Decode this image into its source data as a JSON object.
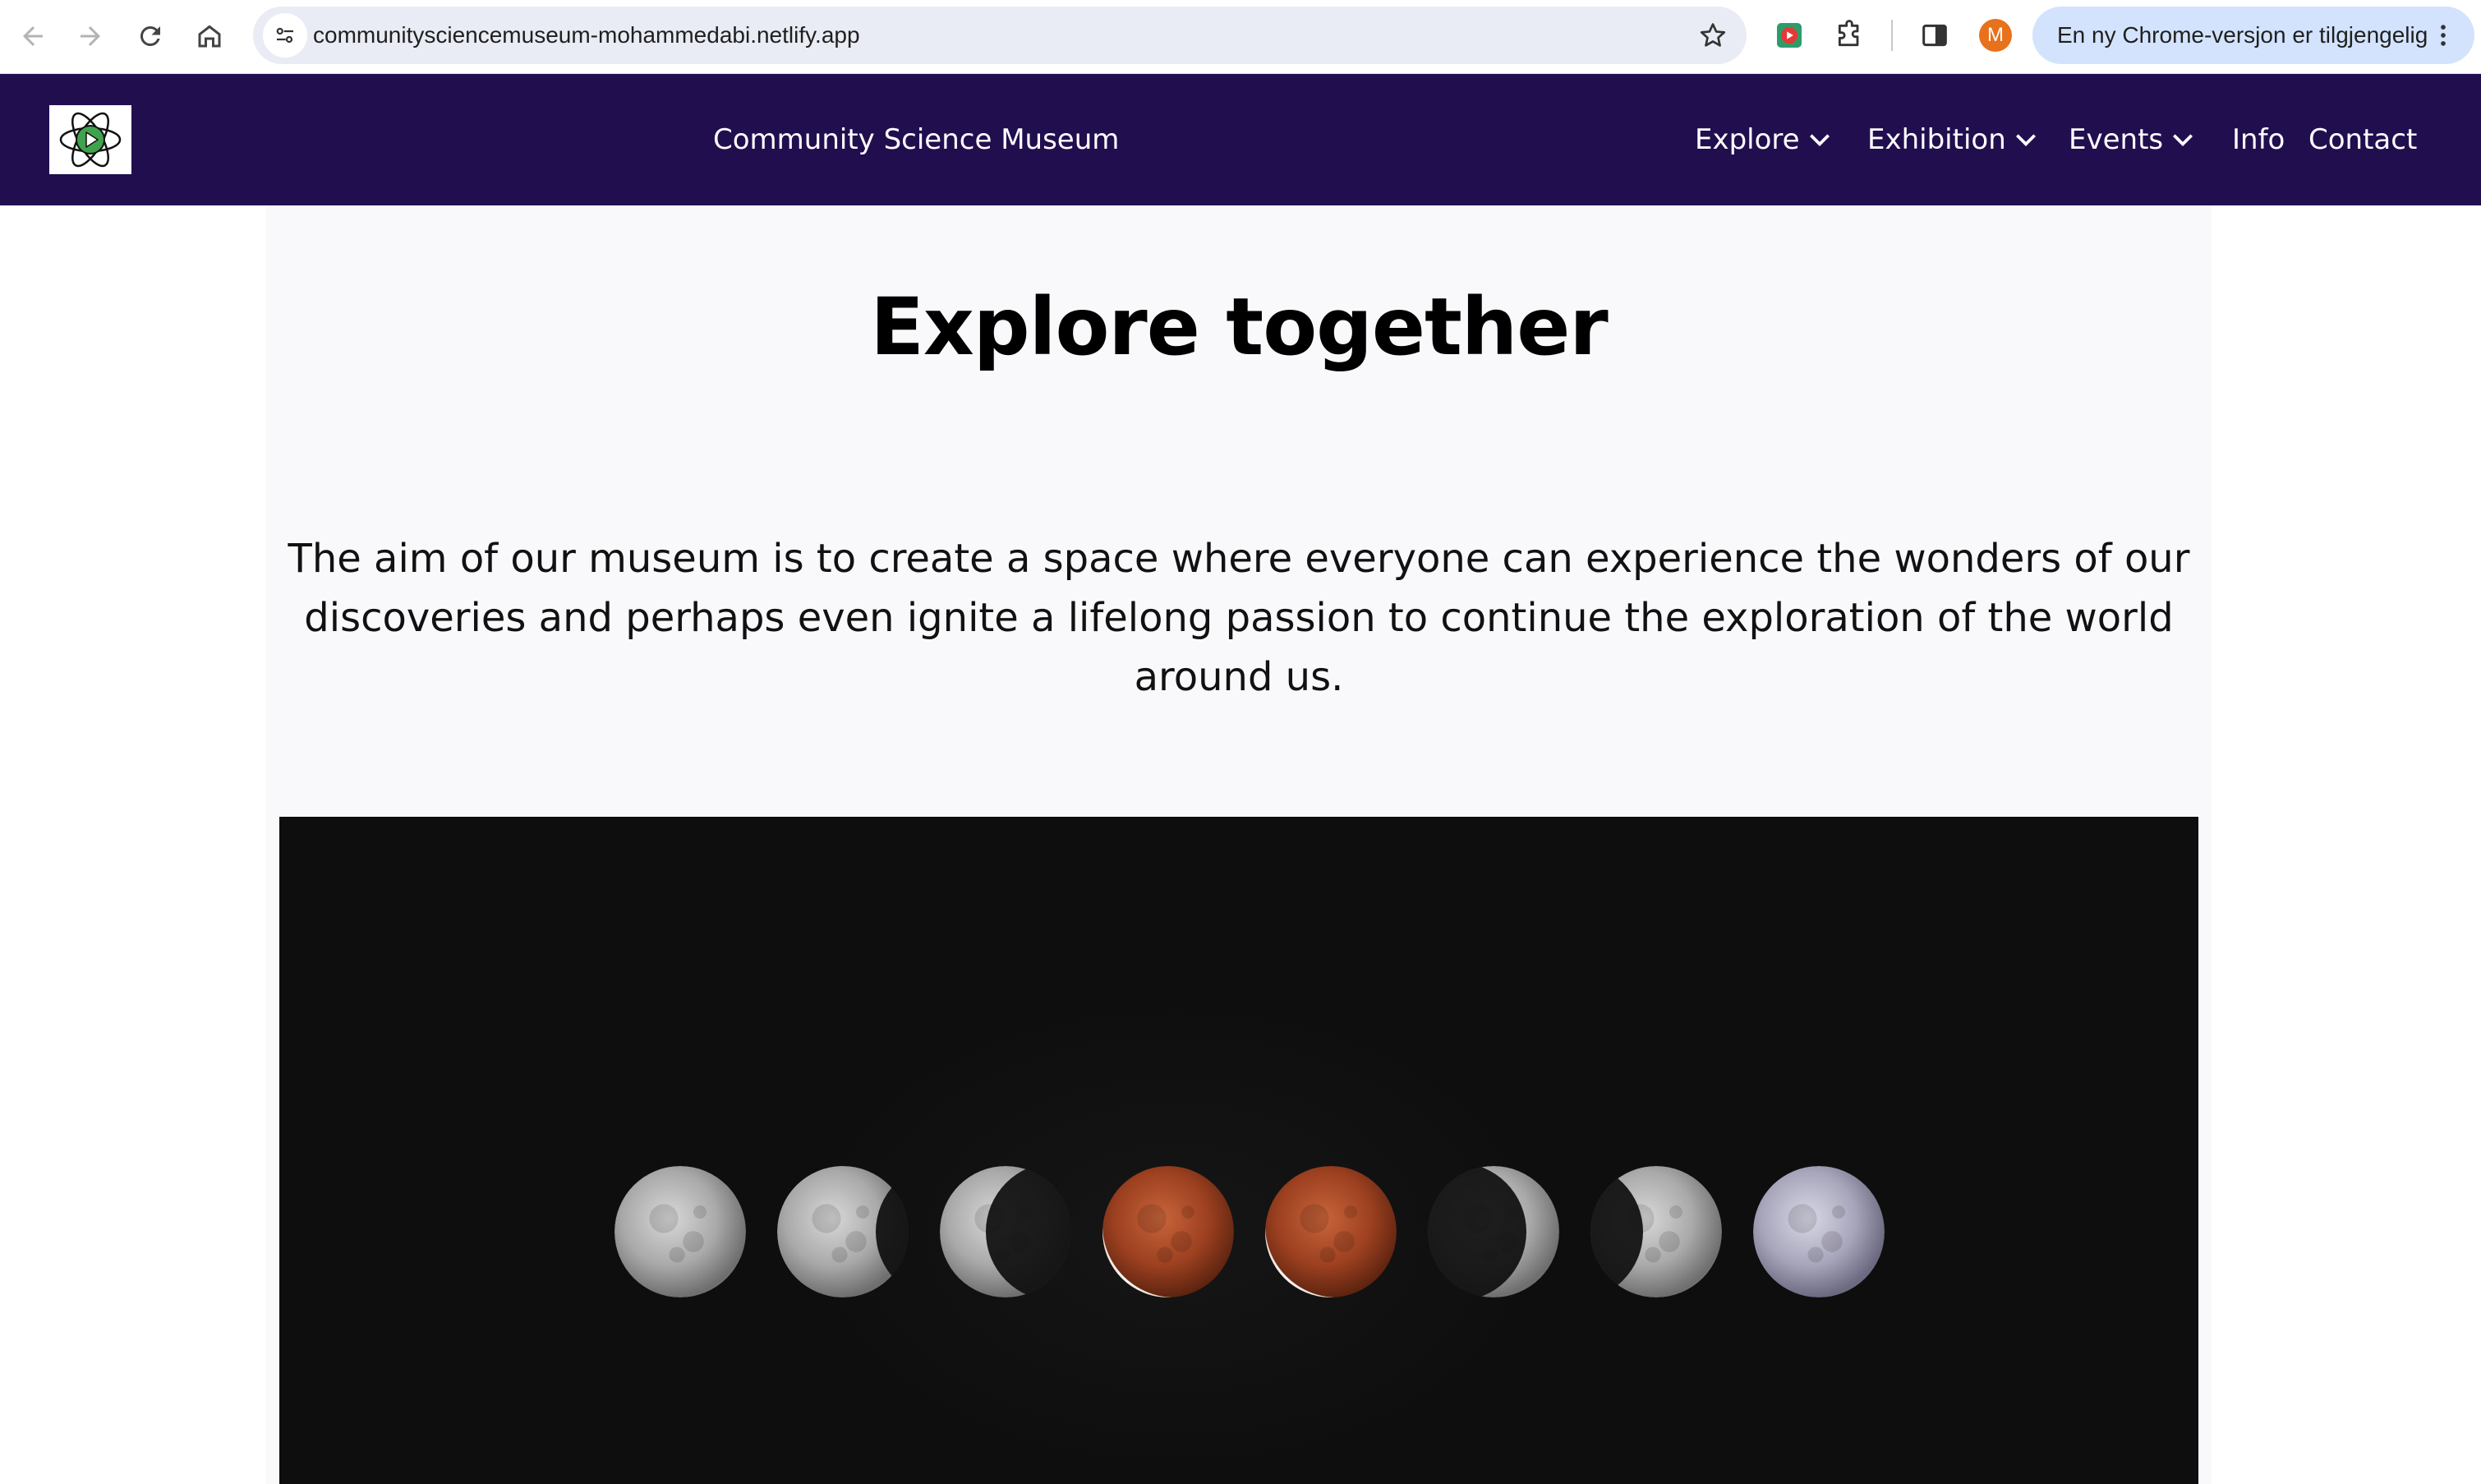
{
  "browser": {
    "url": "communitysciencemuseum-mohammedabi.netlify.app",
    "profile_initial": "M",
    "update_label": "En ny Chrome-versjon er tilgjengelig",
    "icons": [
      "back-arrow-icon",
      "forward-arrow-icon",
      "reload-icon",
      "home-icon",
      "site-settings-icon",
      "bookmark-star-icon",
      "extension-icon",
      "puzzle-icon",
      "side-panel-icon",
      "kebab-menu-icon"
    ],
    "colors": {
      "omnibox": "#e9ecf4",
      "update_pill": "#d3e3fd",
      "avatar": "#e8711c"
    }
  },
  "header": {
    "site_title": "Community Science Museum",
    "nav": {
      "explore": "Explore",
      "exhibition": "Exhibition",
      "events": "Events",
      "info": "Info",
      "contact": "Contact"
    },
    "colors": {
      "background": "#210e4f",
      "text": "#ffffff"
    }
  },
  "main": {
    "title": "Explore together",
    "intro": "The aim of our museum is to create a space where everyone can experience the wonders of our discoveries and perhaps even ignite a lifelong passion to continue the exploration of the world around us.",
    "hero_image": {
      "subject": "lunar-eclipse-phases",
      "moon_phases": 8
    }
  }
}
